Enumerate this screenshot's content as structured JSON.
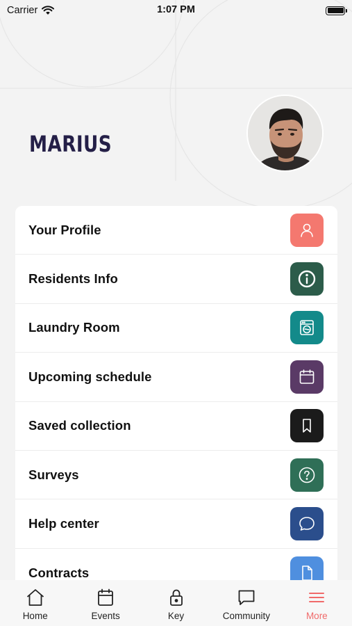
{
  "status_bar": {
    "carrier": "Carrier",
    "time": "1:07 PM"
  },
  "profile": {
    "name": "MARIUS"
  },
  "menu": {
    "items": [
      {
        "label": "Your Profile",
        "icon": "person-icon",
        "color": "#f4786f"
      },
      {
        "label": "Residents Info",
        "icon": "info-icon",
        "color": "#2c5c4a"
      },
      {
        "label": "Laundry Room",
        "icon": "washing-machine-icon",
        "color": "#138a8a"
      },
      {
        "label": "Upcoming schedule",
        "icon": "calendar-icon",
        "color": "#5a3a66"
      },
      {
        "label": "Saved collection",
        "icon": "bookmark-icon",
        "color": "#1b1b1b"
      },
      {
        "label": "Surveys",
        "icon": "question-icon",
        "color": "#2f6f57"
      },
      {
        "label": "Help center",
        "icon": "chat-bubble-icon",
        "color": "#2b4e8c"
      },
      {
        "label": "Contracts",
        "icon": "document-icon",
        "color": "#4f8fdf"
      }
    ]
  },
  "tab_bar": {
    "tabs": [
      {
        "label": "Home",
        "icon": "home-icon",
        "active": false
      },
      {
        "label": "Events",
        "icon": "calendar-icon",
        "active": false
      },
      {
        "label": "Key",
        "icon": "lock-icon",
        "active": false
      },
      {
        "label": "Community",
        "icon": "chat-icon",
        "active": false
      },
      {
        "label": "More",
        "icon": "menu-icon",
        "active": true
      }
    ],
    "active_color": "#f06a6a"
  }
}
